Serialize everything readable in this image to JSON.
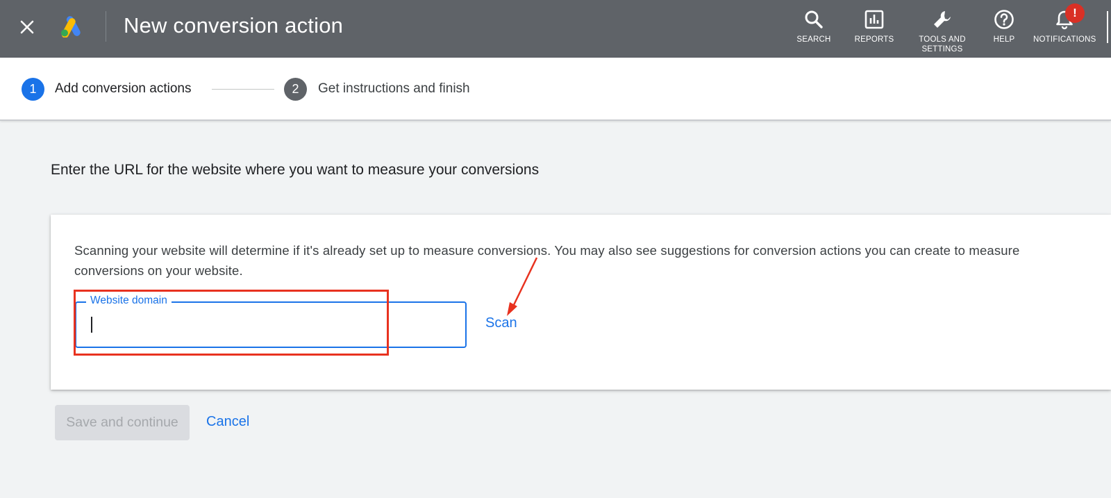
{
  "header": {
    "title": "New conversion action",
    "colors": {
      "bar": "#5f6368",
      "badge": "#d93025"
    },
    "tools": [
      {
        "icon": "search-icon",
        "label": "SEARCH"
      },
      {
        "icon": "reports-icon",
        "label": "REPORTS"
      },
      {
        "icon": "wrench-icon",
        "label_line1": "TOOLS AND",
        "label_line2": "SETTINGS"
      },
      {
        "icon": "help-icon",
        "label": "HELP"
      },
      {
        "icon": "bell-icon",
        "label": "NOTIFICATIONS",
        "badge": "!"
      }
    ]
  },
  "stepper": {
    "steps": [
      {
        "number": "1",
        "label": "Add conversion actions",
        "state": "active",
        "color": "#1a73e8"
      },
      {
        "number": "2",
        "label": "Get instructions and finish",
        "state": "upcoming",
        "color": "#5f6368"
      }
    ]
  },
  "main": {
    "heading": "Enter the URL for the website where you want to measure your conversions",
    "card": {
      "description": "Scanning your website will determine if it's already set up to measure conversions. You may also see suggestions for conversion actions you can create to measure conversions on your website.",
      "field": {
        "label": "Website domain",
        "value": ""
      },
      "scan_label": "Scan",
      "annotation_color": "#e8321f"
    },
    "actions": {
      "save_label": "Save and continue",
      "cancel_label": "Cancel"
    }
  }
}
